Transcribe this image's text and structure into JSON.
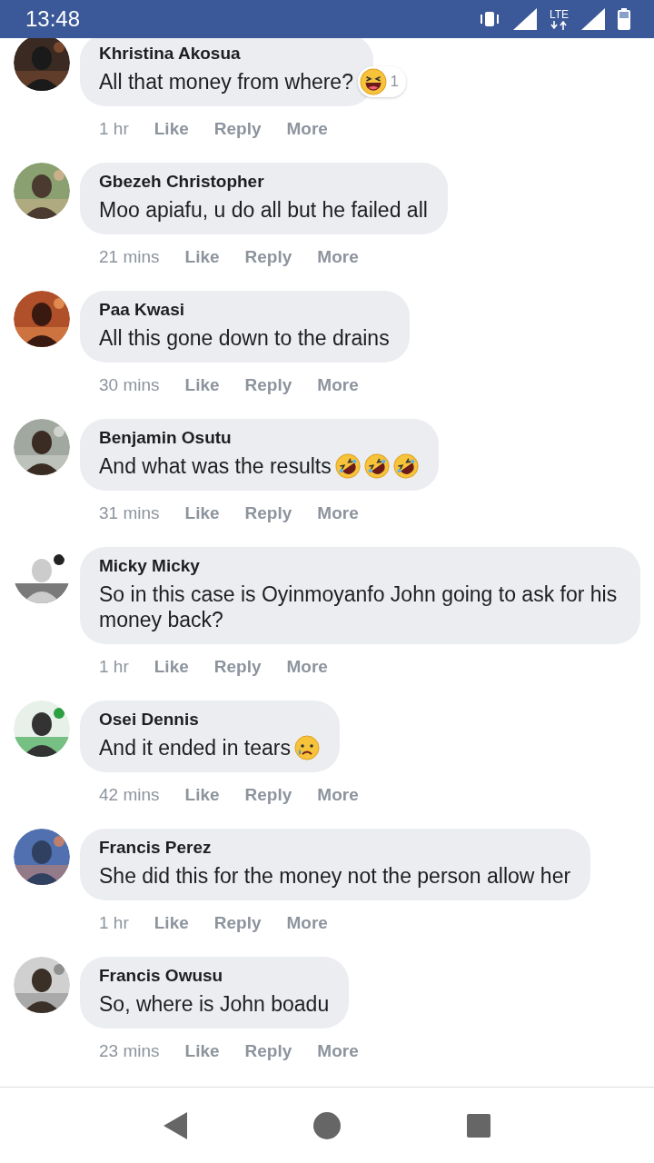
{
  "status_bar": {
    "time": "13:48",
    "network": "LTE"
  },
  "comments": [
    {
      "name": "Khristina Akosua",
      "text": "All that money from where?",
      "reaction": {
        "kind": "haha",
        "count": "1"
      },
      "time": "1 hr",
      "actions": [
        "Like",
        "Reply",
        "More"
      ]
    },
    {
      "name": "Gbezeh Christopher",
      "text": "Moo apiafu, u do all but he failed all",
      "time": "21 mins",
      "actions": [
        "Like",
        "Reply",
        "More"
      ]
    },
    {
      "name": "Paa Kwasi",
      "text": "All this gone down to the drains",
      "time": "30 mins",
      "actions": [
        "Like",
        "Reply",
        "More"
      ]
    },
    {
      "name": "Benjamin Osutu",
      "text": "And what was the results",
      "emoji": [
        {
          "kind": "rofl"
        },
        {
          "kind": "rofl"
        },
        {
          "kind": "rofl"
        }
      ],
      "time": "31 mins",
      "actions": [
        "Like",
        "Reply",
        "More"
      ]
    },
    {
      "name": "Micky Micky",
      "text": "So in this case is Oyinmoyanfo John going to ask for his money back?",
      "time": "1 hr",
      "actions": [
        "Like",
        "Reply",
        "More"
      ]
    },
    {
      "name": "Osei Dennis",
      "text": "And it ended in tears",
      "emoji": [
        {
          "kind": "sad"
        }
      ],
      "time": "42 mins",
      "actions": [
        "Like",
        "Reply",
        "More"
      ]
    },
    {
      "name": "Francis Perez",
      "text": "She did this for the money not the person allow her",
      "time": "1 hr",
      "actions": [
        "Like",
        "Reply",
        "More"
      ]
    },
    {
      "name": "Francis Owusu",
      "text": "So, where is John boadu",
      "time": "23 mins",
      "actions": [
        "Like",
        "Reply",
        "More"
      ]
    }
  ]
}
